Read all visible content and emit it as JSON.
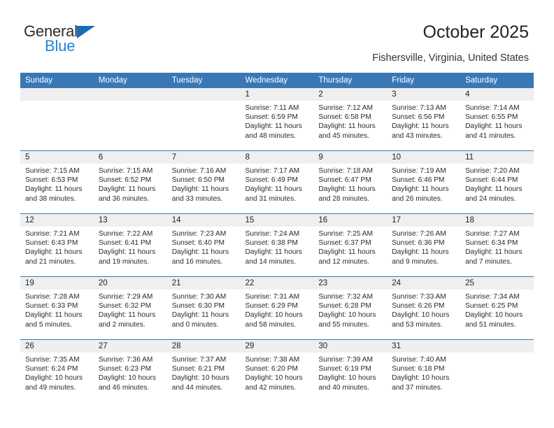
{
  "brand": {
    "logo_word_1": "General",
    "logo_word_2": "Blue",
    "logo_icon": "triangle-icon",
    "accent_dark": "#1a6bb5",
    "accent_light": "#1f86d8"
  },
  "header": {
    "title": "October 2025",
    "location": "Fishersville, Virginia, United States"
  },
  "theme": {
    "header_row_bg": "#3a78b5",
    "day_number_bg": "#efefef",
    "cell_bg": "#ffffff",
    "text": "#2a2a2a"
  },
  "weekday_headers": [
    "Sunday",
    "Monday",
    "Tuesday",
    "Wednesday",
    "Thursday",
    "Friday",
    "Saturday"
  ],
  "weeks": [
    [
      {
        "day": "",
        "blank": true
      },
      {
        "day": "",
        "blank": true
      },
      {
        "day": "",
        "blank": true
      },
      {
        "day": "1",
        "sunrise": "Sunrise: 7:11 AM",
        "sunset": "Sunset: 6:59 PM",
        "daylight_1": "Daylight: 11 hours",
        "daylight_2": "and 48 minutes."
      },
      {
        "day": "2",
        "sunrise": "Sunrise: 7:12 AM",
        "sunset": "Sunset: 6:58 PM",
        "daylight_1": "Daylight: 11 hours",
        "daylight_2": "and 45 minutes."
      },
      {
        "day": "3",
        "sunrise": "Sunrise: 7:13 AM",
        "sunset": "Sunset: 6:56 PM",
        "daylight_1": "Daylight: 11 hours",
        "daylight_2": "and 43 minutes."
      },
      {
        "day": "4",
        "sunrise": "Sunrise: 7:14 AM",
        "sunset": "Sunset: 6:55 PM",
        "daylight_1": "Daylight: 11 hours",
        "daylight_2": "and 41 minutes."
      }
    ],
    [
      {
        "day": "5",
        "sunrise": "Sunrise: 7:15 AM",
        "sunset": "Sunset: 6:53 PM",
        "daylight_1": "Daylight: 11 hours",
        "daylight_2": "and 38 minutes."
      },
      {
        "day": "6",
        "sunrise": "Sunrise: 7:15 AM",
        "sunset": "Sunset: 6:52 PM",
        "daylight_1": "Daylight: 11 hours",
        "daylight_2": "and 36 minutes."
      },
      {
        "day": "7",
        "sunrise": "Sunrise: 7:16 AM",
        "sunset": "Sunset: 6:50 PM",
        "daylight_1": "Daylight: 11 hours",
        "daylight_2": "and 33 minutes."
      },
      {
        "day": "8",
        "sunrise": "Sunrise: 7:17 AM",
        "sunset": "Sunset: 6:49 PM",
        "daylight_1": "Daylight: 11 hours",
        "daylight_2": "and 31 minutes."
      },
      {
        "day": "9",
        "sunrise": "Sunrise: 7:18 AM",
        "sunset": "Sunset: 6:47 PM",
        "daylight_1": "Daylight: 11 hours",
        "daylight_2": "and 28 minutes."
      },
      {
        "day": "10",
        "sunrise": "Sunrise: 7:19 AM",
        "sunset": "Sunset: 6:46 PM",
        "daylight_1": "Daylight: 11 hours",
        "daylight_2": "and 26 minutes."
      },
      {
        "day": "11",
        "sunrise": "Sunrise: 7:20 AM",
        "sunset": "Sunset: 6:44 PM",
        "daylight_1": "Daylight: 11 hours",
        "daylight_2": "and 24 minutes."
      }
    ],
    [
      {
        "day": "12",
        "sunrise": "Sunrise: 7:21 AM",
        "sunset": "Sunset: 6:43 PM",
        "daylight_1": "Daylight: 11 hours",
        "daylight_2": "and 21 minutes."
      },
      {
        "day": "13",
        "sunrise": "Sunrise: 7:22 AM",
        "sunset": "Sunset: 6:41 PM",
        "daylight_1": "Daylight: 11 hours",
        "daylight_2": "and 19 minutes."
      },
      {
        "day": "14",
        "sunrise": "Sunrise: 7:23 AM",
        "sunset": "Sunset: 6:40 PM",
        "daylight_1": "Daylight: 11 hours",
        "daylight_2": "and 16 minutes."
      },
      {
        "day": "15",
        "sunrise": "Sunrise: 7:24 AM",
        "sunset": "Sunset: 6:38 PM",
        "daylight_1": "Daylight: 11 hours",
        "daylight_2": "and 14 minutes."
      },
      {
        "day": "16",
        "sunrise": "Sunrise: 7:25 AM",
        "sunset": "Sunset: 6:37 PM",
        "daylight_1": "Daylight: 11 hours",
        "daylight_2": "and 12 minutes."
      },
      {
        "day": "17",
        "sunrise": "Sunrise: 7:26 AM",
        "sunset": "Sunset: 6:36 PM",
        "daylight_1": "Daylight: 11 hours",
        "daylight_2": "and 9 minutes."
      },
      {
        "day": "18",
        "sunrise": "Sunrise: 7:27 AM",
        "sunset": "Sunset: 6:34 PM",
        "daylight_1": "Daylight: 11 hours",
        "daylight_2": "and 7 minutes."
      }
    ],
    [
      {
        "day": "19",
        "sunrise": "Sunrise: 7:28 AM",
        "sunset": "Sunset: 6:33 PM",
        "daylight_1": "Daylight: 11 hours",
        "daylight_2": "and 5 minutes."
      },
      {
        "day": "20",
        "sunrise": "Sunrise: 7:29 AM",
        "sunset": "Sunset: 6:32 PM",
        "daylight_1": "Daylight: 11 hours",
        "daylight_2": "and 2 minutes."
      },
      {
        "day": "21",
        "sunrise": "Sunrise: 7:30 AM",
        "sunset": "Sunset: 6:30 PM",
        "daylight_1": "Daylight: 11 hours",
        "daylight_2": "and 0 minutes."
      },
      {
        "day": "22",
        "sunrise": "Sunrise: 7:31 AM",
        "sunset": "Sunset: 6:29 PM",
        "daylight_1": "Daylight: 10 hours",
        "daylight_2": "and 58 minutes."
      },
      {
        "day": "23",
        "sunrise": "Sunrise: 7:32 AM",
        "sunset": "Sunset: 6:28 PM",
        "daylight_1": "Daylight: 10 hours",
        "daylight_2": "and 55 minutes."
      },
      {
        "day": "24",
        "sunrise": "Sunrise: 7:33 AM",
        "sunset": "Sunset: 6:26 PM",
        "daylight_1": "Daylight: 10 hours",
        "daylight_2": "and 53 minutes."
      },
      {
        "day": "25",
        "sunrise": "Sunrise: 7:34 AM",
        "sunset": "Sunset: 6:25 PM",
        "daylight_1": "Daylight: 10 hours",
        "daylight_2": "and 51 minutes."
      }
    ],
    [
      {
        "day": "26",
        "sunrise": "Sunrise: 7:35 AM",
        "sunset": "Sunset: 6:24 PM",
        "daylight_1": "Daylight: 10 hours",
        "daylight_2": "and 49 minutes."
      },
      {
        "day": "27",
        "sunrise": "Sunrise: 7:36 AM",
        "sunset": "Sunset: 6:23 PM",
        "daylight_1": "Daylight: 10 hours",
        "daylight_2": "and 46 minutes."
      },
      {
        "day": "28",
        "sunrise": "Sunrise: 7:37 AM",
        "sunset": "Sunset: 6:21 PM",
        "daylight_1": "Daylight: 10 hours",
        "daylight_2": "and 44 minutes."
      },
      {
        "day": "29",
        "sunrise": "Sunrise: 7:38 AM",
        "sunset": "Sunset: 6:20 PM",
        "daylight_1": "Daylight: 10 hours",
        "daylight_2": "and 42 minutes."
      },
      {
        "day": "30",
        "sunrise": "Sunrise: 7:39 AM",
        "sunset": "Sunset: 6:19 PM",
        "daylight_1": "Daylight: 10 hours",
        "daylight_2": "and 40 minutes."
      },
      {
        "day": "31",
        "sunrise": "Sunrise: 7:40 AM",
        "sunset": "Sunset: 6:18 PM",
        "daylight_1": "Daylight: 10 hours",
        "daylight_2": "and 37 minutes."
      },
      {
        "day": "",
        "blank": true
      }
    ]
  ]
}
